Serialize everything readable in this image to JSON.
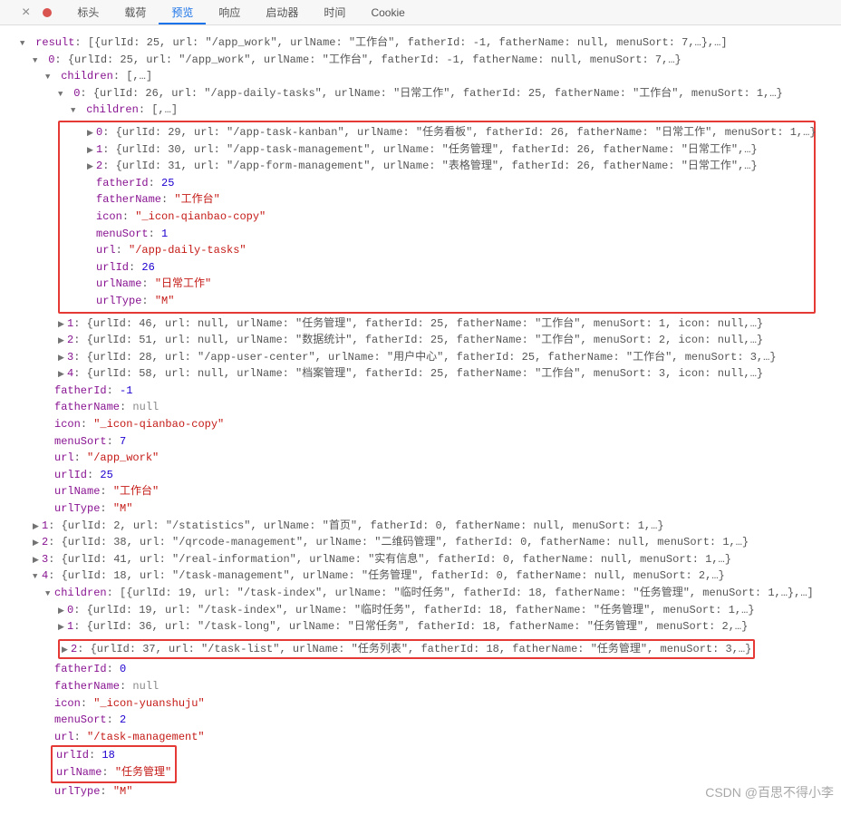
{
  "tabs": {
    "headers": "标头",
    "payload": "载荷",
    "preview": "预览",
    "response": "响应",
    "initiator": "启动器",
    "timing": "时间",
    "cookie": "Cookie"
  },
  "keys": {
    "result": "result",
    "children": "children",
    "fatherId": "fatherId",
    "fatherName": "fatherName",
    "icon": "icon",
    "menuSort": "menuSort",
    "url": "url",
    "urlId": "urlId",
    "urlName": "urlName",
    "urlType": "urlType"
  },
  "result_summary": "[{urlId: 25, url: \"/app_work\", urlName: \"工作台\", fatherId: -1, fatherName: null, menuSort: 7,…},…]",
  "idx0_summary": "{urlId: 25, url: \"/app_work\", urlName: \"工作台\", fatherId: -1, fatherName: null, menuSort: 7,…}",
  "children_collapsed": "[,…]",
  "c0_summary": "{urlId: 26, url: \"/app-daily-tasks\", urlName: \"日常工作\", fatherId: 25, fatherName: \"工作台\", menuSort: 1,…}",
  "c0_children_header": "[,…]",
  "c0_children": {
    "i0": "{urlId: 29, url: \"/app-task-kanban\", urlName: \"任务看板\", fatherId: 26, fatherName: \"日常工作\", menuSort: 1,…}",
    "i1": "{urlId: 30, url: \"/app-task-management\", urlName: \"任务管理\", fatherId: 26, fatherName: \"日常工作\",…}",
    "i2": "{urlId: 31, url: \"/app-form-management\", urlName: \"表格管理\", fatherId: 26, fatherName: \"日常工作\",…}"
  },
  "c0_detail": {
    "fatherId": "25",
    "fatherName": "\"工作台\"",
    "icon": "\"_icon-qianbao-copy\"",
    "menuSort": "1",
    "url": "\"/app-daily-tasks\"",
    "urlId": "26",
    "urlName": "\"日常工作\"",
    "urlType": "\"M\""
  },
  "idx0_children_rest": {
    "i1": "{urlId: 46, url: null, urlName: \"任务管理\", fatherId: 25, fatherName: \"工作台\", menuSort: 1, icon: null,…}",
    "i2": "{urlId: 51, url: null, urlName: \"数据统计\", fatherId: 25, fatherName: \"工作台\", menuSort: 2, icon: null,…}",
    "i3": "{urlId: 28, url: \"/app-user-center\", urlName: \"用户中心\", fatherId: 25, fatherName: \"工作台\", menuSort: 3,…}",
    "i4": "{urlId: 58, url: null, urlName: \"档案管理\", fatherId: 25, fatherName: \"工作台\", menuSort: 3, icon: null,…}"
  },
  "idx0_detail": {
    "fatherId": "-1",
    "fatherName": "null",
    "icon": "\"_icon-qianbao-copy\"",
    "menuSort": "7",
    "url": "\"/app_work\"",
    "urlId": "25",
    "urlName": "\"工作台\"",
    "urlType": "\"M\""
  },
  "top_rest": {
    "i1": "{urlId: 2, url: \"/statistics\", urlName: \"首页\", fatherId: 0, fatherName: null, menuSort: 1,…}",
    "i2": "{urlId: 38, url: \"/qrcode-management\", urlName: \"二维码管理\", fatherId: 0, fatherName: null, menuSort: 1,…}",
    "i3": "{urlId: 41, url: \"/real-information\", urlName: \"实有信息\", fatherId: 0, fatherName: null, menuSort: 1,…}",
    "i4": "{urlId: 18, url: \"/task-management\", urlName: \"任务管理\", fatherId: 0, fatherName: null, menuSort: 2,…}"
  },
  "i4_children_header": "[{urlId: 19, url: \"/task-index\", urlName: \"临时任务\", fatherId: 18, fatherName: \"任务管理\", menuSort: 1,…},…]",
  "i4_children": {
    "i0": "{urlId: 19, url: \"/task-index\", urlName: \"临时任务\", fatherId: 18, fatherName: \"任务管理\", menuSort: 1,…}",
    "i1": "{urlId: 36, url: \"/task-long\", urlName: \"日常任务\", fatherId: 18, fatherName: \"任务管理\", menuSort: 2,…}",
    "i2": "{urlId: 37, url: \"/task-list\", urlName: \"任务列表\", fatherId: 18, fatherName: \"任务管理\", menuSort: 3,…}"
  },
  "i4_detail": {
    "fatherId": "0",
    "fatherName": "null",
    "icon": "\"_icon-yuanshuju\"",
    "menuSort": "2",
    "url": "\"/task-management\"",
    "urlId": "18",
    "urlName": "\"任务管理\"",
    "urlType": "\"M\""
  },
  "watermark": "CSDN @百思不得小李"
}
